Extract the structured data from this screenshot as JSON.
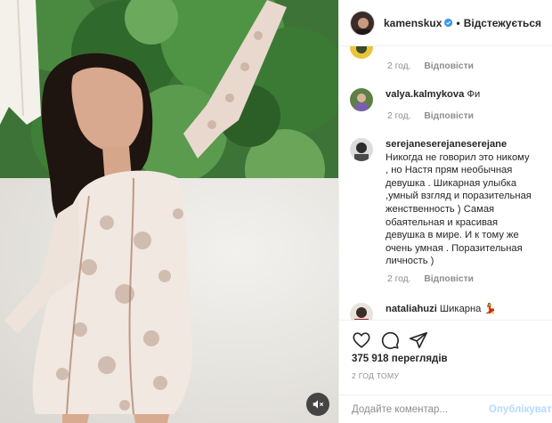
{
  "header": {
    "username": "kamenskux",
    "dot": "•",
    "follow_label": "Відстежується"
  },
  "comments": [
    {
      "username": "",
      "text": "",
      "time": "2 год.",
      "reply": "Відповісти"
    },
    {
      "username": "valya.kalmykova",
      "text": "Фи",
      "time": "2 год.",
      "reply": "Відповісти"
    },
    {
      "username": "serejaneserejaneserejane",
      "lines": [
        "Никогда не говорил это никому",
        ", но Настя прям необычная",
        "девушка . Шикарная улыбка",
        ",умный взгляд и поразительная",
        "женственность ) Самая",
        "обаятельная и красивая",
        "девушка в мире. И к тому же",
        "очень умная . Поразительная",
        "личность )"
      ],
      "time": "2 год.",
      "reply": "Відповісти"
    },
    {
      "username": "nataliahuzi",
      "text": "Шикарна 💃"
    }
  ],
  "stats": {
    "views": "375 918 переглядів",
    "time_ago": "2 ГОД ТОМУ"
  },
  "add_comment": {
    "placeholder": "Додайте коментар...",
    "publish_label": "Опублікувати"
  },
  "icons": [
    "heart-icon",
    "comment-icon",
    "share-icon",
    "mute-icon",
    "verified-icon"
  ],
  "colors": {
    "verified": "#3897f0",
    "publish": "#b3dbff",
    "meta": "#8e8e8e",
    "text": "#262626"
  }
}
